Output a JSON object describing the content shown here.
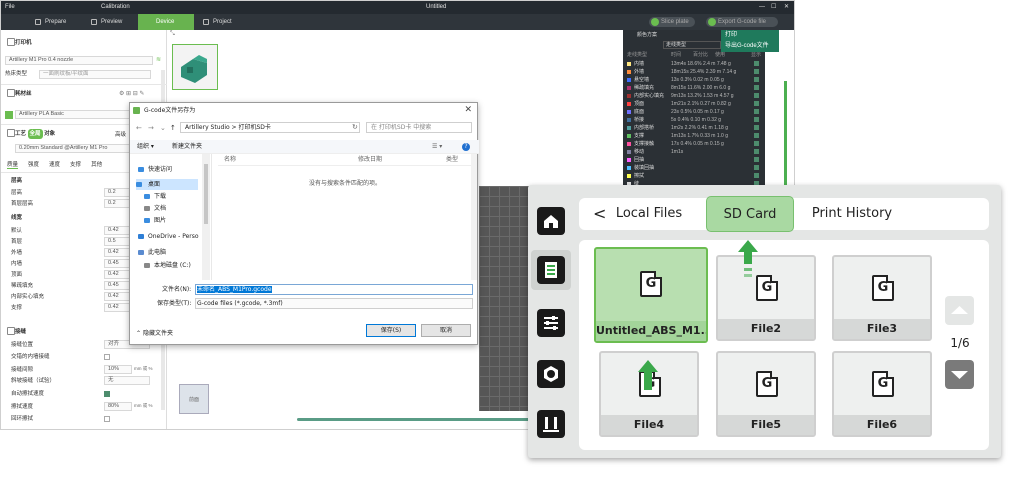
{
  "slicer": {
    "titlebar": {
      "file_menu": "File",
      "calibration": "Calibration",
      "doc_title": "Untitled"
    },
    "toolbar": {
      "prepare": "Prepare",
      "preview": "Preview",
      "device": "Device",
      "project": "Project",
      "slice_plate": "Slice plate",
      "export_gcode": "Export G-code file"
    },
    "export_menu": [
      "打印",
      "导出G-code文件"
    ],
    "left": {
      "printer_section": "打印机",
      "printer_name": "Artillery M1 Pro 0.4 nozzle",
      "plate_type_label": "热床类型",
      "plate_type_placeholder": "一面刷纹板/平纹面",
      "filament_section": "耗材丝",
      "filament_name": "Artillery PLA Basic",
      "process_section": "工艺",
      "process_global": "全局",
      "process_object": "对象",
      "process_advanced": "高级",
      "process_profile": "0.20mm Standard @Artillery M1 Pro",
      "tabs": [
        "质量",
        "强度",
        "速度",
        "支撑",
        "其他"
      ],
      "layer_head": "层高",
      "layer_rows": [
        {
          "label": "层高",
          "value": "0.2"
        },
        {
          "label": "首层层高",
          "value": "0.2"
        }
      ],
      "width_head": "线宽",
      "width_rows": [
        {
          "label": "默认",
          "value": "0.42"
        },
        {
          "label": "首层",
          "value": "0.5"
        },
        {
          "label": "外墙",
          "value": "0.42"
        },
        {
          "label": "内墙",
          "value": "0.45"
        },
        {
          "label": "顶面",
          "value": "0.42"
        },
        {
          "label": "稀疏填充",
          "value": "0.45"
        },
        {
          "label": "内部实心填充",
          "value": "0.42"
        },
        {
          "label": "支撑",
          "value": "0.42"
        }
      ],
      "seam_head": "接缝",
      "seam_rows": [
        {
          "label": "接缝位置",
          "value": "对齐"
        },
        {
          "label": "交错的内墙接缝",
          "value": ""
        },
        {
          "label": "接缝间隙",
          "value": "10%"
        },
        {
          "label": "斜坡接缝（试验）",
          "value": "无"
        },
        {
          "label": "自动擦拭速度",
          "value": ""
        },
        {
          "label": "擦拭速度",
          "value": "80%"
        },
        {
          "label": "回环擦拭",
          "value": ""
        }
      ],
      "unit_mm_pct": "mm 或 %"
    },
    "preview": {
      "scheme_label": "颜色方案",
      "scheme_value": "走线类型",
      "columns": [
        "走线类型",
        "时间",
        "百分比",
        "使用",
        "显示"
      ],
      "rows": [
        {
          "name": "内墙",
          "vals": "13m4s  18.6%  2.4 m  7.48 g",
          "color": "#ffe680"
        },
        {
          "name": "外墙",
          "vals": "18m15s  25.4%  2.39 m  7.14 g",
          "color": "#ff8c3a"
        },
        {
          "name": "悬空墙",
          "vals": "13s  0.3%  0.02 m  0.05 g",
          "color": "#3f6fff"
        },
        {
          "name": "稀疏填充",
          "vals": "8m15s  11.6%  2.00 m  6.0 g",
          "color": "#b0306e"
        },
        {
          "name": "内部实心填充",
          "vals": "9m13s  13.2%  1.53 m  4.57 g",
          "color": "#a03030"
        },
        {
          "name": "顶面",
          "vals": "1m21s  2.1%  0.27 m  0.82 g",
          "color": "#ff4040"
        },
        {
          "name": "底面",
          "vals": "23s  0.5%  0.05 m  0.17 g",
          "color": "#7070ff"
        },
        {
          "name": "桥接",
          "vals": "5s  0.4%  0.10 m  0.32 g",
          "color": "#4070a0"
        },
        {
          "name": "内部搭桥",
          "vals": "1m2s  2.2%  0.41 m  1.18 g",
          "color": "#50a0a0"
        },
        {
          "name": "支撑",
          "vals": "1m13s  1.7%  0.33 m  1.0 g",
          "color": "#60c060"
        },
        {
          "name": "支撑接触",
          "vals": "17s  0.4%  0.05 m  0.15 g",
          "color": "#ff50a0"
        },
        {
          "name": "移动",
          "vals": "1m1s",
          "color": "#8080a0"
        },
        {
          "name": "回抽",
          "vals": "",
          "color": "#ff60ff"
        },
        {
          "name": "装填回抽",
          "vals": "",
          "color": "#50c0ff"
        },
        {
          "name": "擦拭",
          "vals": "",
          "color": "#ffff50"
        },
        {
          "name": "缝",
          "vals": "",
          "color": "#e0e0e0"
        }
      ]
    },
    "cube_label": "前面"
  },
  "dialog": {
    "title": "G-code文件另存为",
    "close": "✕",
    "path": "Artillery Studio  >  打印机SD卡",
    "search_placeholder": "在 打印机SD卡 中搜索",
    "organize": "组织 ▾",
    "new_folder": "新建文件夹",
    "tree": [
      {
        "label": "快速访问",
        "color": "#3a8de0"
      },
      {
        "label": "桌面",
        "color": "#3a8de0"
      },
      {
        "label": "下载",
        "color": "#3a8de0"
      },
      {
        "label": "文档",
        "color": "#888888"
      },
      {
        "label": "图片",
        "color": "#3a8de0"
      },
      {
        "label": "OneDrive - Perso",
        "color": "#2f7fd6"
      },
      {
        "label": "此电脑",
        "color": "#5a8bd0"
      },
      {
        "label": "本地磁盘 (C:)",
        "color": "#888888"
      }
    ],
    "col_name": "名称",
    "col_date": "修改日期",
    "col_type": "类型",
    "empty_text": "没有与搜索条件匹配的项。",
    "filename_label": "文件名(N):",
    "filename_value": "未命名_ABS_M1Pro.gcode",
    "filetype_label": "保存类型(T):",
    "filetype_value": "G-code files (*.gcode, *.3mf)",
    "hide_folders": "隐藏文件夹",
    "save": "保存(S)",
    "cancel": "取消"
  },
  "touch": {
    "tabs": {
      "local": "Local Files",
      "sd": "SD Card",
      "history": "Print History"
    },
    "files": [
      "Untitled_ABS_M1...",
      "File2",
      "File3",
      "File4",
      "File5",
      "File6"
    ],
    "file_glyph": "G",
    "page_indicator": "1/6",
    "accent": "#6bbd50",
    "arrow_color": "#3aa84a"
  }
}
